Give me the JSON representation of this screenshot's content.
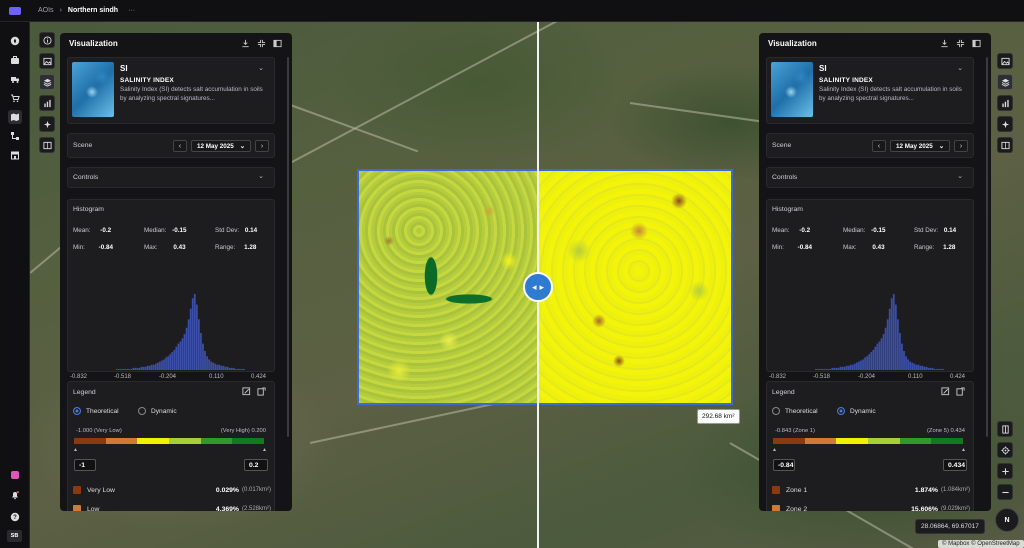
{
  "breadcrumb": {
    "root": "AOIs",
    "current": "Northern sindh",
    "more": "···"
  },
  "map": {
    "area_label": "292.68 km²",
    "coordinates": "28.06864, 69.67017",
    "attribution": "© Mapbox © OpenStreetMap",
    "compass_label": "N"
  },
  "user": {
    "initials": "SB"
  },
  "panels": [
    {
      "title": "Visualization",
      "index": {
        "code": "SI",
        "name": "SALINITY INDEX",
        "description": "Salinity Index (SI) detects salt accumulation in soils by analyzing spectral signatures..."
      },
      "scene": {
        "label": "Scene",
        "date": "12 May 2025"
      },
      "controls_label": "Controls",
      "histogram": {
        "label": "Histogram",
        "stats": {
          "mean_label": "Mean:",
          "mean": "-0.2",
          "median_label": "Median:",
          "median": "-0.15",
          "std_label": "Std Dev:",
          "std": "0.14",
          "min_label": "Min:",
          "min": "-0.84",
          "max_label": "Max:",
          "max": "0.43",
          "range_label": "Range:",
          "range": "1.28"
        },
        "ticks": [
          "-0.832",
          "-0.518",
          "-0.204",
          "0.110",
          "0.424"
        ]
      },
      "legend": {
        "label": "Legend",
        "mode_theoretical": "Theoretical",
        "mode_dynamic": "Dynamic",
        "selected_mode": "theoretical",
        "range_left": "-1.000 (Very Low)",
        "range_right": "(Very High) 0.200",
        "min_value": "-1",
        "max_value": "0.2",
        "rows": [
          {
            "name": "Very Low",
            "pct": "0.029%",
            "km": "(0.017km²)",
            "color": "#8b3a0f"
          },
          {
            "name": "Low",
            "pct": "4.369%",
            "km": "(2.528km²)",
            "color": "#d07a35"
          }
        ]
      }
    },
    {
      "title": "Visualization",
      "index": {
        "code": "SI",
        "name": "SALINITY INDEX",
        "description": "Salinity Index (SI) detects salt accumulation in soils by analyzing spectral signatures..."
      },
      "scene": {
        "label": "Scene",
        "date": "12 May 2025"
      },
      "controls_label": "Controls",
      "histogram": {
        "label": "Histogram",
        "stats": {
          "mean_label": "Mean:",
          "mean": "-0.2",
          "median_label": "Median:",
          "median": "-0.15",
          "std_label": "Std Dev:",
          "std": "0.14",
          "min_label": "Min:",
          "min": "-0.84",
          "max_label": "Max:",
          "max": "0.43",
          "range_label": "Range:",
          "range": "1.28"
        },
        "ticks": [
          "-0.832",
          "-0.518",
          "-0.204",
          "0.110",
          "0.424"
        ]
      },
      "legend": {
        "label": "Legend",
        "mode_theoretical": "Theoretical",
        "mode_dynamic": "Dynamic",
        "selected_mode": "dynamic",
        "range_left": "-0.843 (Zone 1)",
        "range_right": "(Zone 5) 0.434",
        "min_value": "-0.84",
        "max_value": "0.434",
        "rows": [
          {
            "name": "Zone 1",
            "pct": "1.874%",
            "km": "(1.084km²)",
            "color": "#8b3a0f"
          },
          {
            "name": "Zone 2",
            "pct": "15.606%",
            "km": "(9.029km²)",
            "color": "#d07a35"
          }
        ]
      }
    }
  ],
  "legend_colors": [
    "#8b3a0f",
    "#d07a35",
    "#f2f200",
    "#a6cf3a",
    "#2f9a2a",
    "#0f7a1e"
  ],
  "histogram_bins": [
    1,
    1,
    1,
    1,
    1,
    1,
    1,
    1,
    2,
    2,
    2,
    2,
    3,
    3,
    3,
    4,
    4,
    5,
    5,
    6,
    7,
    8,
    9,
    10,
    12,
    13,
    15,
    17,
    19,
    22,
    25,
    27,
    30,
    34,
    40,
    48,
    58,
    68,
    72,
    62,
    48,
    35,
    25,
    18,
    13,
    10,
    8,
    7,
    6,
    5,
    5,
    4,
    4,
    3,
    3,
    2,
    2,
    2,
    1,
    1,
    1,
    1,
    1
  ]
}
